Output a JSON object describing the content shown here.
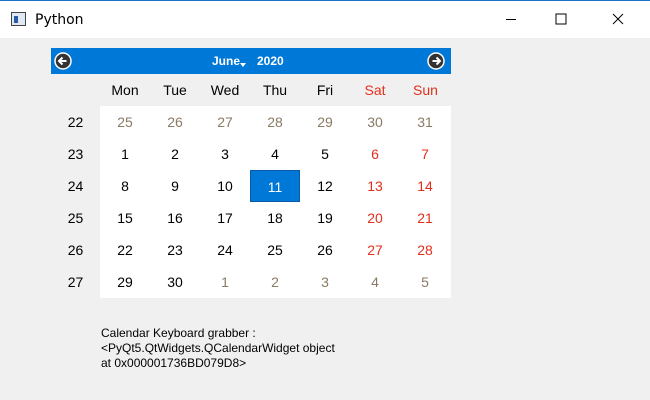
{
  "window": {
    "title": "Python",
    "controls": [
      "minimize-icon",
      "maximize-icon",
      "close-icon"
    ]
  },
  "calendar": {
    "month": "June",
    "year": "2020",
    "prev_icon": "left-arrow-circle-icon",
    "next_icon": "right-arrow-circle-icon",
    "day_headers": [
      "Mon",
      "Tue",
      "Wed",
      "Thu",
      "Fri",
      "Sat",
      "Sun"
    ],
    "week_numbers": [
      "22",
      "23",
      "24",
      "25",
      "26",
      "27"
    ],
    "weeks": [
      [
        "25",
        "26",
        "27",
        "28",
        "29",
        "30",
        "31"
      ],
      [
        "1",
        "2",
        "3",
        "4",
        "5",
        "6",
        "7"
      ],
      [
        "8",
        "9",
        "10",
        "11",
        "12",
        "13",
        "14"
      ],
      [
        "15",
        "16",
        "17",
        "18",
        "19",
        "20",
        "21"
      ],
      [
        "22",
        "23",
        "24",
        "25",
        "26",
        "27",
        "28"
      ],
      [
        "29",
        "30",
        "1",
        "2",
        "3",
        "4",
        "5"
      ]
    ],
    "selected_day": "11",
    "colors": {
      "accent": "#0078d7",
      "weekend": "#e0301e",
      "other_month": "#8a7a64"
    }
  },
  "info": {
    "line1": "Calendar Keyboard grabber :",
    "line2": "<PyQt5.QtWidgets.QCalendarWidget object",
    "line3": "at 0x000001736BD079D8>"
  }
}
